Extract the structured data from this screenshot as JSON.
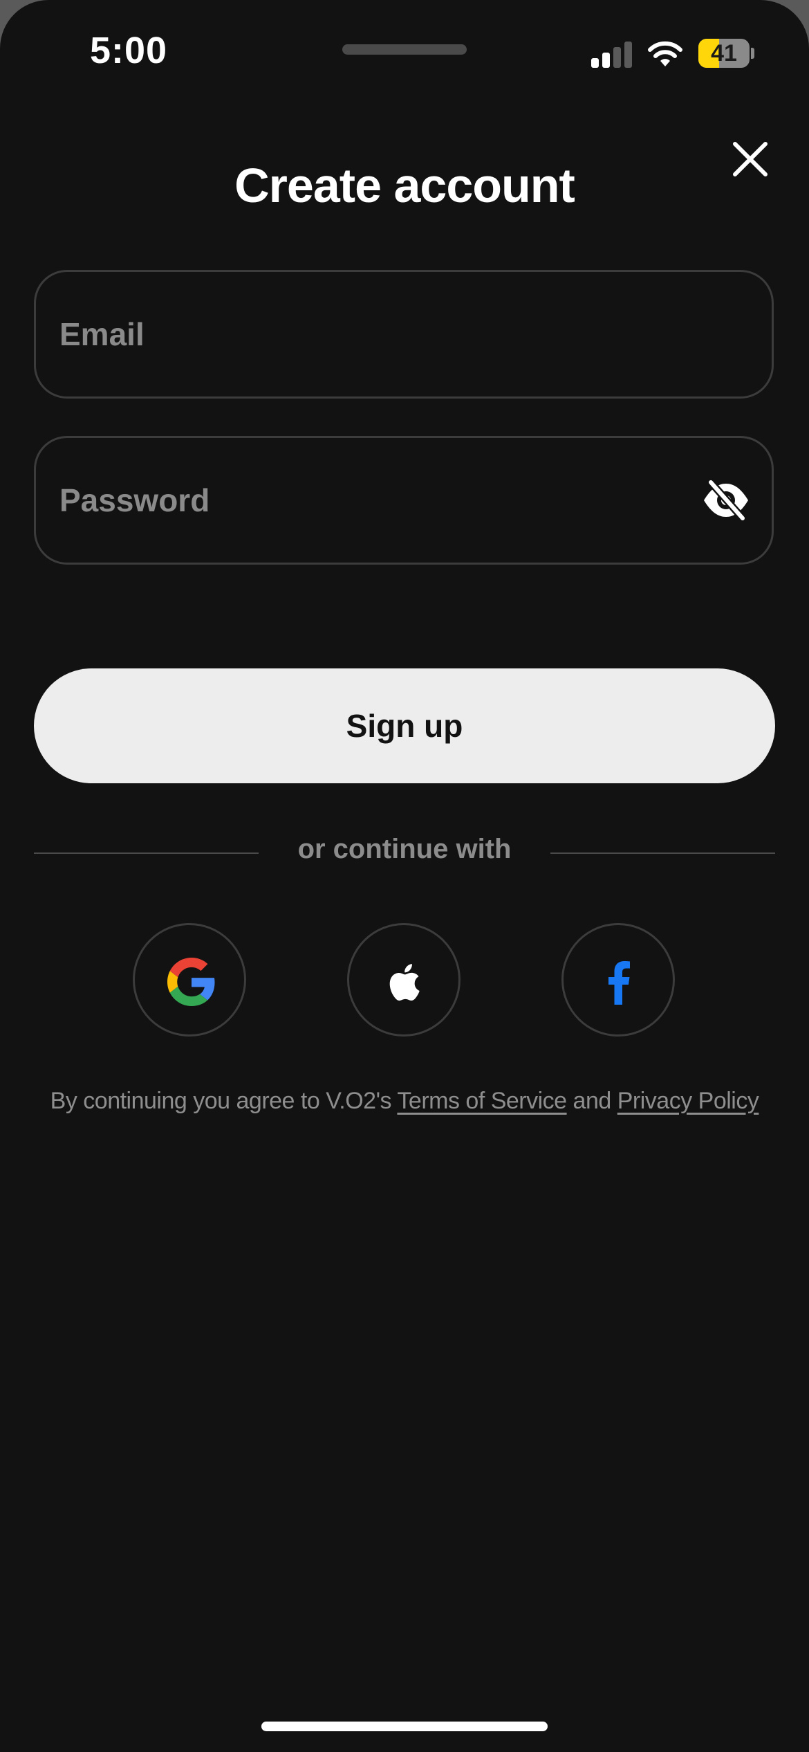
{
  "status_bar": {
    "time": "5:00",
    "battery": "41",
    "battery_level": 0.41
  },
  "header": {
    "title": "Create account",
    "close_icon": "close-icon"
  },
  "form": {
    "email": {
      "placeholder": "Email",
      "value": ""
    },
    "password": {
      "placeholder": "Password",
      "value": "",
      "toggle_icon": "eye-off-icon"
    },
    "submit_label": "Sign up"
  },
  "divider": {
    "label": "or continue with"
  },
  "social": [
    {
      "icon": "google-icon"
    },
    {
      "icon": "apple-icon"
    },
    {
      "icon": "facebook-icon"
    }
  ],
  "legal": {
    "prefix": "By continuing you agree to V.O2's",
    "terms": "Terms of Service",
    "conjunction": "and",
    "privacy": "Privacy Policy"
  },
  "colors": {
    "background": "#121212",
    "button_bg": "#ededed",
    "battery_yellow": "#ffd60a",
    "facebook_blue": "#1877f2"
  }
}
